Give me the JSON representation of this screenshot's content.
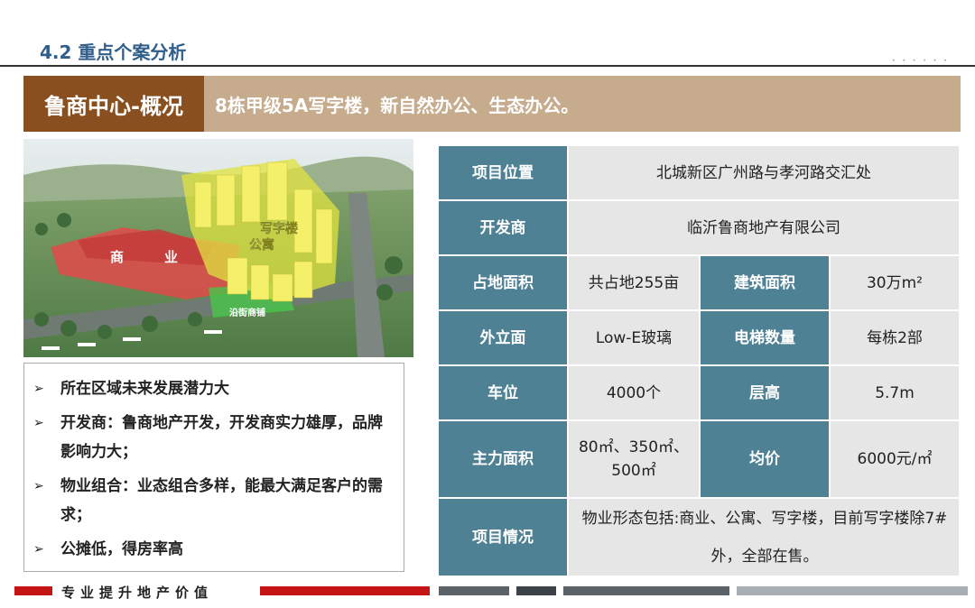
{
  "header": {
    "section_title": "4.2  重点个案分析"
  },
  "banner": {
    "title": "鲁商中心-概况",
    "subtitle": "8栋甲级5A写字楼，新自然办公、生态办公。"
  },
  "photo": {
    "labels": {
      "office": "写字楼",
      "apartment": "公寓",
      "commerce_1": "商",
      "commerce_2": "业",
      "street_shops": "沿街商铺"
    }
  },
  "bullets": [
    "所在区域未来发展潜力大",
    "开发商：鲁商地产开发，开发商实力雄厚，品牌影响力大；",
    "物业组合：业态组合多样，能最大满足客户的需求；",
    "公摊低，得房率高"
  ],
  "table": {
    "location": {
      "label": "项目位置",
      "value": "北城新区广州路与孝河路交汇处"
    },
    "developer": {
      "label": "开发商",
      "value": "临沂鲁商地产有限公司"
    },
    "land_area": {
      "label": "占地面积",
      "value": "共占地255亩"
    },
    "building_area": {
      "label": "建筑面积",
      "value": "30万m²"
    },
    "facade": {
      "label": "外立面",
      "value": "Low-E玻璃"
    },
    "elevators": {
      "label": "电梯数量",
      "value": "每栋2部"
    },
    "parking": {
      "label": "车位",
      "value": "4000个"
    },
    "floor_height": {
      "label": "层高",
      "value": "5.7m"
    },
    "main_area": {
      "label": "主力面积",
      "value": "80㎡、350㎡、500㎡"
    },
    "avg_price": {
      "label": "均价",
      "value": "6000元/㎡"
    },
    "status": {
      "label": "项目情况",
      "value": "物业形态包括:商业、公寓、写字楼，目前写字楼除7#外，全部在售。"
    }
  },
  "footer": {
    "slogan": "专业提升地产价值"
  }
}
